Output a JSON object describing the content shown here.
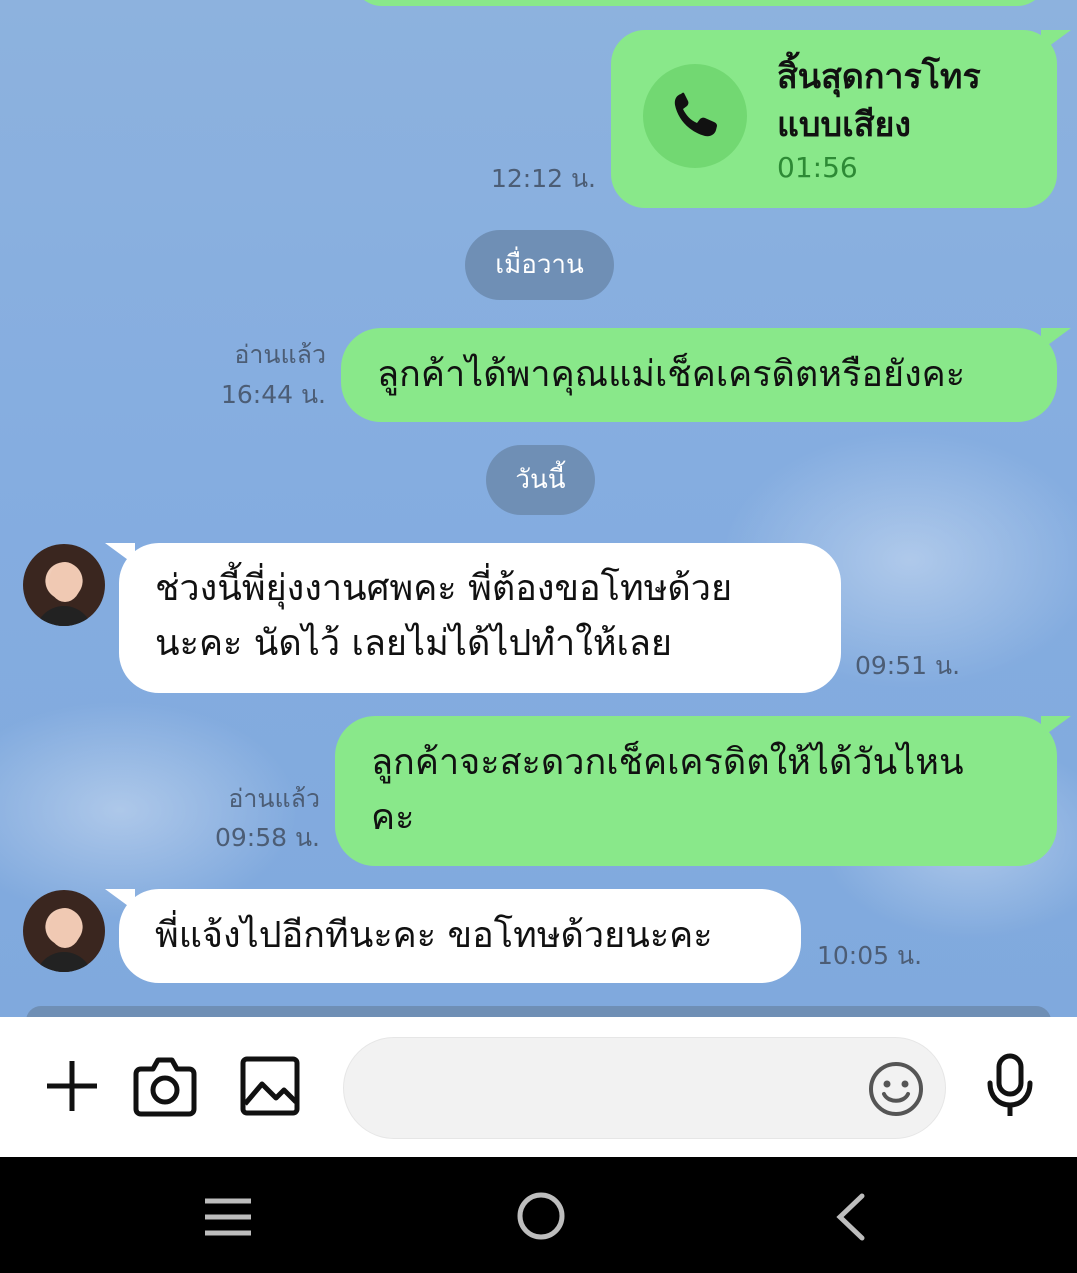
{
  "messages": {
    "call": {
      "title_line1": "สิ้นสุดการโทร",
      "title_line2": "แบบเสียง",
      "duration": "01:56",
      "time": "12:12 น.",
      "icon": "phone-icon"
    },
    "date_yesterday": "เมื่อวาน",
    "sent1": {
      "text": "ลูกค้าได้พาคุณแม่เช็คเครดิตหรือยังคะ",
      "status": "อ่านแล้ว",
      "time": "16:44 น."
    },
    "date_today": "วันนี้",
    "recv1": {
      "line1": "ช่วงนี้พี่ยุ่งงานศพคะ พี่ต้องขอโทษด้วย",
      "line2": "นะคะ นัดไว้ เลยไม่ได้ไปทำให้เลย",
      "time": "09:51 น."
    },
    "sent2": {
      "line1": "ลูกค้าจะสะดวกเช็คเครดิตให้ได้วันไหน",
      "line2": "คะ",
      "status": "อ่านแล้ว",
      "time": "09:58 น."
    },
    "recv2": {
      "text": "พี่แจ้งไปอีกทีนะคะ ขอโทษด้วยนะคะ",
      "time": "10:05 น."
    }
  },
  "input_bar": {
    "message_value": "",
    "icons": [
      "plus-icon",
      "camera-icon",
      "image-icon",
      "emoji-icon",
      "microphone-icon"
    ]
  },
  "nav_bar": {
    "icons": [
      "recent-apps-icon",
      "home-icon",
      "back-icon"
    ]
  },
  "colors": {
    "sent_bubble": "#89e88a",
    "received_bubble": "#ffffff",
    "chat_background": "#85ade0",
    "date_pill": "#6f8fb5"
  }
}
